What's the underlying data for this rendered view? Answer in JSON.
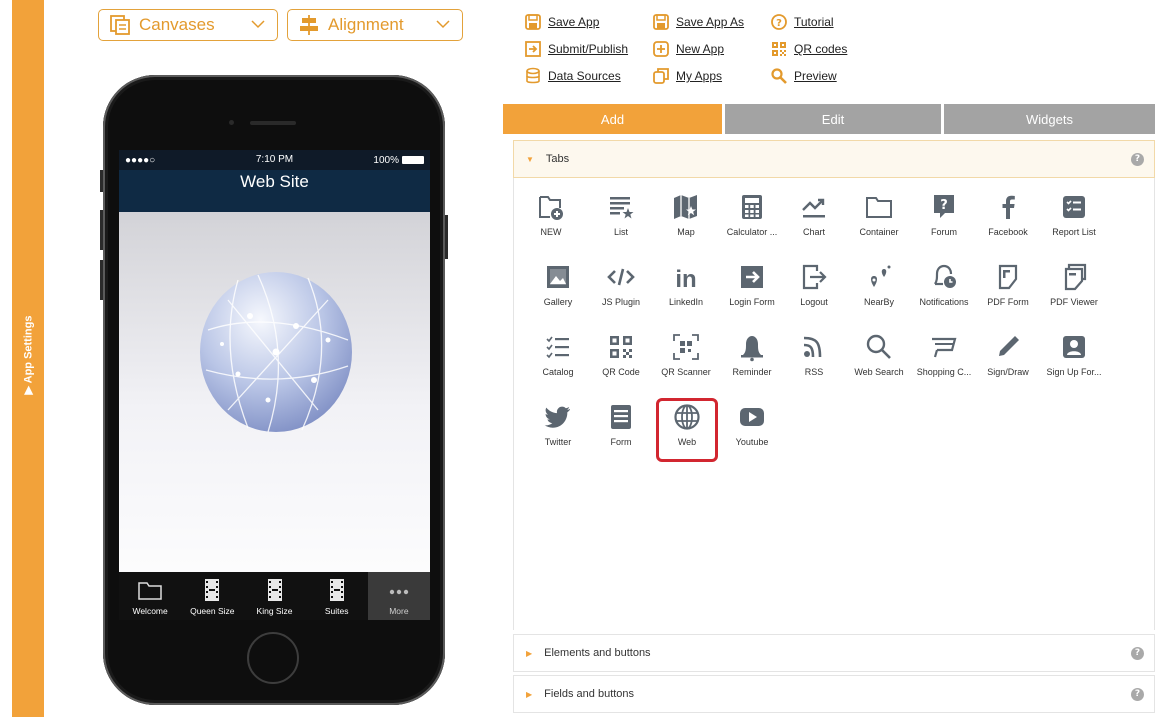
{
  "sidebar": {
    "label": "▶ App Settings"
  },
  "toolbar": {
    "canvases": {
      "label": "Canvases",
      "icon": "canvases-icon"
    },
    "alignment": {
      "label": "Alignment",
      "icon": "alignment-icon"
    }
  },
  "menu": {
    "save_app": "Save App",
    "save_app_as": "Save App As",
    "tutorial": "Tutorial",
    "submit_publish": "Submit/Publish",
    "new_app": "New App",
    "qr_codes": "QR codes",
    "data_sources": "Data Sources",
    "my_apps": "My Apps",
    "preview": "Preview"
  },
  "phone": {
    "status": {
      "signal": "●●●●○",
      "time": "7:10 PM",
      "battery": "100%"
    },
    "title": "Web Site",
    "tabs": [
      "Welcome",
      "Queen Size",
      "King Size",
      "Suites",
      "More"
    ]
  },
  "tabs": {
    "add": "Add",
    "edit": "Edit",
    "widgets": "Widgets"
  },
  "sections": {
    "tabs": "Tabs",
    "elements": "Elements and buttons",
    "fields": "Fields and buttons",
    "help": "?"
  },
  "widgets": [
    [
      "NEW",
      "List",
      "Map",
      "Calculator ...",
      "Chart",
      "Container",
      "Forum",
      "Facebook",
      "Report List"
    ],
    [
      "Gallery",
      "JS Plugin",
      "LinkedIn",
      "Login Form",
      "Logout",
      "NearBy",
      "Notifications",
      "PDF Form",
      "PDF Viewer"
    ],
    [
      "Catalog",
      "QR Code",
      "QR Scanner",
      "Reminder",
      "RSS",
      "Web Search",
      "Shopping C...",
      "Sign/Draw",
      "Sign Up For..."
    ],
    [
      "Twitter",
      "Form",
      "Web",
      "Youtube"
    ]
  ],
  "highlighted_widget": "Web",
  "colors": {
    "accent": "#f2a23a",
    "highlight": "#d22630",
    "tab_inactive": "#a3a3a3",
    "phone_title_bg": "#0f2a44"
  }
}
